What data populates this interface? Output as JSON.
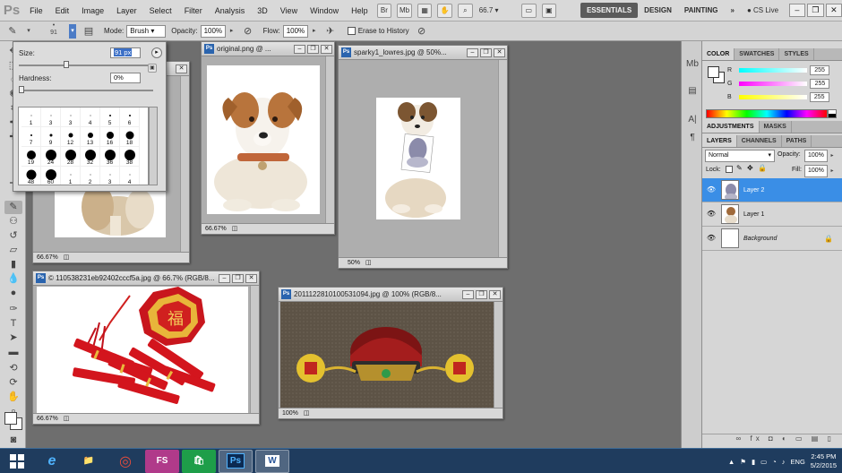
{
  "menubar": {
    "logo": "Ps",
    "items": [
      "File",
      "Edit",
      "Image",
      "Layer",
      "Select",
      "Filter",
      "Analysis",
      "3D",
      "View",
      "Window",
      "Help"
    ],
    "buttons": [
      "Br",
      "Mb"
    ],
    "zoom": "66.7",
    "workspaces": [
      "ESSENTIALS",
      "DESIGN",
      "PAINTING"
    ],
    "more": "»",
    "cslive": "CS Live"
  },
  "options": {
    "brush_size": "91",
    "mode_label": "Mode:",
    "mode_value": "Brush",
    "opacity_label": "Opacity:",
    "opacity_value": "100%",
    "flow_label": "Flow:",
    "flow_value": "100%",
    "erase_history_label": "Erase to History"
  },
  "brush_popup": {
    "size_label": "Size:",
    "size_value": "91 px",
    "hardness_label": "Hardness:",
    "hardness_value": "0%",
    "size_fraction": 0.35,
    "hardness_fraction": 0.0,
    "presets": [
      {
        "label": "1",
        "d": 1
      },
      {
        "label": "3",
        "d": 1
      },
      {
        "label": "3",
        "d": 1
      },
      {
        "label": "4",
        "d": 1
      },
      {
        "label": "5",
        "d": 2
      },
      {
        "label": "6",
        "d": 2
      },
      {
        "label": "7",
        "d": 2
      },
      {
        "label": "9",
        "d": 3
      },
      {
        "label": "12",
        "d": 5
      },
      {
        "label": "13",
        "d": 6
      },
      {
        "label": "16",
        "d": 8
      },
      {
        "label": "18",
        "d": 9
      },
      {
        "label": "19",
        "d": 10
      },
      {
        "label": "24",
        "d": 12
      },
      {
        "label": "28",
        "d": 12
      },
      {
        "label": "32",
        "d": 12
      },
      {
        "label": "36",
        "d": 12
      },
      {
        "label": "38",
        "d": 12
      },
      {
        "label": "48",
        "d": 11
      },
      {
        "label": "60",
        "d": 12
      },
      {
        "label": "1",
        "d": 1
      },
      {
        "label": "2",
        "d": 1
      },
      {
        "label": "3",
        "d": 1
      },
      {
        "label": "4",
        "d": 1
      }
    ]
  },
  "documents": [
    {
      "title": "",
      "zoom": "66.67%"
    },
    {
      "title": "original.png @ ...",
      "zoom": "66.67%"
    },
    {
      "title": "sparky1_lowres.jpg @ 50%...",
      "zoom": "50%"
    },
    {
      "title": "© 110538231eb92402cccf5a.jpg @ 66.7% (RGB/8...",
      "zoom": "66.67%"
    },
    {
      "title": "2011122810100531094.jpg @ 100% (RGB/8...",
      "zoom": "100%"
    }
  ],
  "panels": {
    "color_tabs": [
      "COLOR",
      "SWATCHES",
      "STYLES"
    ],
    "channels": [
      {
        "name": "R",
        "value": "255"
      },
      {
        "name": "G",
        "value": "255"
      },
      {
        "name": "B",
        "value": "255"
      }
    ],
    "adjust_tabs": [
      "ADJUSTMENTS",
      "MASKS"
    ],
    "layers_tabs": [
      "LAYERS",
      "CHANNELS",
      "PATHS"
    ],
    "blend_mode": "Normal",
    "opacity_label": "Opacity:",
    "opacity_value": "100%",
    "lock_label": "Lock:",
    "fill_label": "Fill:",
    "fill_value": "100%",
    "layers": [
      {
        "name": "Layer 2",
        "selected": true,
        "italic": false
      },
      {
        "name": "Layer 1",
        "selected": false,
        "italic": false
      },
      {
        "name": "Background",
        "selected": false,
        "italic": true
      }
    ],
    "footer_icons": "∞ fx ◘ ◐ ▭ ▤ ▯"
  },
  "taskbar": {
    "lang": "ENG",
    "time": "2:45 PM",
    "date": "5/2/2015",
    "apps": [
      "e",
      "📁",
      "◎",
      "FS",
      "🛍",
      "Ps",
      "W"
    ]
  },
  "colors": {
    "accent": "#3a8ee6",
    "workspace_active": "#5b5b5b",
    "taskbar": "#1f3c5e",
    "ps_blue": "#2a64ae"
  }
}
